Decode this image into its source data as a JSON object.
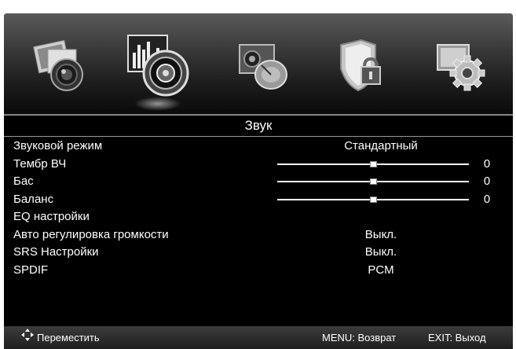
{
  "menu": {
    "title": "Звук",
    "icons": [
      {
        "name": "picture-menu-icon",
        "active": false
      },
      {
        "name": "sound-menu-icon",
        "active": true
      },
      {
        "name": "channel-menu-icon",
        "active": false
      },
      {
        "name": "lock-menu-icon",
        "active": false
      },
      {
        "name": "setup-menu-icon",
        "active": false
      }
    ],
    "items": [
      {
        "label": "Звуковой режим",
        "value": "Стандартный"
      },
      {
        "label": "Тембр ВЧ",
        "level": 0.5,
        "number": "0"
      },
      {
        "label": "Бас",
        "level": 0.5,
        "number": "0"
      },
      {
        "label": "Баланс",
        "level": 0.5,
        "number": "0"
      },
      {
        "label": "EQ настройки"
      },
      {
        "label": "Авто регулировка громкости",
        "value": "Выкл."
      },
      {
        "label": "SRS Настройки",
        "value": "Выкл."
      },
      {
        "label": "SPDIF",
        "value": "PCM"
      }
    ]
  },
  "help": {
    "move": "Переместить",
    "menu": "MENU: Возврат",
    "exit": "EXIT: Выход"
  },
  "colors": {
    "background": "#000000",
    "text": "#ffffff"
  }
}
